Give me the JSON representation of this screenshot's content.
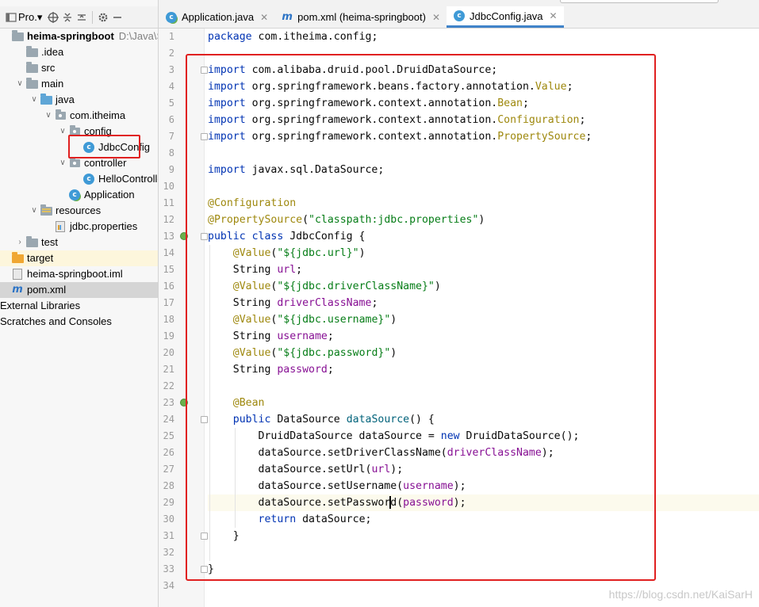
{
  "project_toolbar": {
    "view_label": "Pro.▾",
    "icons": [
      "globe-icon",
      "collapse-icon",
      "expand-icon",
      "gear-icon",
      "minimize-icon"
    ]
  },
  "tree": [
    {
      "label": "heima-springboot",
      "hint": "D:\\Java\\Spring",
      "icon": "module-folder",
      "bold": true,
      "indent": 0,
      "arrow": ""
    },
    {
      "label": ".idea",
      "icon": "folder",
      "indent": 1,
      "arrow": ""
    },
    {
      "label": "src",
      "icon": "folder",
      "indent": 1,
      "arrow": ""
    },
    {
      "label": "main",
      "icon": "folder",
      "indent": 1,
      "arrow": "down"
    },
    {
      "label": "java",
      "icon": "source-folder",
      "indent": 2,
      "arrow": "down"
    },
    {
      "label": "com.itheima",
      "icon": "package",
      "indent": 3,
      "arrow": "down"
    },
    {
      "label": "config",
      "icon": "package",
      "indent": 4,
      "arrow": "down"
    },
    {
      "label": "JdbcConfig",
      "icon": "class",
      "indent": 5,
      "arrow": ""
    },
    {
      "label": "controller",
      "icon": "package",
      "indent": 4,
      "arrow": "down"
    },
    {
      "label": "HelloController",
      "icon": "class",
      "indent": 5,
      "arrow": ""
    },
    {
      "label": "Application",
      "icon": "spring-class",
      "indent": 4,
      "arrow": ""
    },
    {
      "label": "resources",
      "icon": "resources-folder",
      "indent": 2,
      "arrow": "down"
    },
    {
      "label": "jdbc.properties",
      "icon": "properties-file",
      "indent": 3,
      "arrow": ""
    },
    {
      "label": "test",
      "icon": "folder",
      "indent": 1,
      "arrow": "right"
    },
    {
      "label": "target",
      "icon": "excluded-folder",
      "indent": 0,
      "arrow": "",
      "excluded": true
    },
    {
      "label": "heima-springboot.iml",
      "icon": "iml-file",
      "indent": 0,
      "arrow": ""
    },
    {
      "label": "pom.xml",
      "icon": "maven-file",
      "indent": 0,
      "arrow": "",
      "selected": true
    },
    {
      "label": "External Libraries",
      "icon": "none",
      "indent": 0,
      "arrow": ""
    },
    {
      "label": "Scratches and Consoles",
      "icon": "none",
      "indent": 0,
      "arrow": ""
    }
  ],
  "tabs": [
    {
      "label": "Application.java",
      "icon": "spring-class",
      "active": false
    },
    {
      "label": "pom.xml (heima-springboot)",
      "icon": "maven-file",
      "active": false
    },
    {
      "label": "JdbcConfig.java",
      "icon": "class",
      "active": true
    }
  ],
  "editor": {
    "current_line": 29,
    "lines": [
      [
        [
          "kw",
          "package "
        ],
        [
          "p",
          "com.itheima.config;"
        ]
      ],
      [],
      [
        [
          "kw",
          "import "
        ],
        [
          "p",
          "com.alibaba.druid.pool.DruidDataSource;"
        ]
      ],
      [
        [
          "kw",
          "import "
        ],
        [
          "p",
          "org.springframework.beans.factory.annotation."
        ],
        [
          "ann",
          "Value"
        ],
        [
          "p",
          ";"
        ]
      ],
      [
        [
          "kw",
          "import "
        ],
        [
          "p",
          "org.springframework.context.annotation."
        ],
        [
          "ann",
          "Bean"
        ],
        [
          "p",
          ";"
        ]
      ],
      [
        [
          "kw",
          "import "
        ],
        [
          "p",
          "org.springframework.context.annotation."
        ],
        [
          "ann",
          "Configuration"
        ],
        [
          "p",
          ";"
        ]
      ],
      [
        [
          "kw",
          "import "
        ],
        [
          "p",
          "org.springframework.context.annotation."
        ],
        [
          "ann",
          "PropertySource"
        ],
        [
          "p",
          ";"
        ]
      ],
      [],
      [
        [
          "kw",
          "import "
        ],
        [
          "p",
          "javax.sql.DataSource;"
        ]
      ],
      [],
      [
        [
          "ann",
          "@Configuration"
        ]
      ],
      [
        [
          "ann",
          "@PropertySource"
        ],
        [
          "p",
          "("
        ],
        [
          "str",
          "\"classpath:jdbc.properties\""
        ],
        [
          "p",
          ")"
        ]
      ],
      [
        [
          "kw",
          "public class "
        ],
        [
          "p",
          "JdbcConfig {"
        ]
      ],
      [
        [
          "p",
          "    "
        ],
        [
          "ann",
          "@Value"
        ],
        [
          "p",
          "("
        ],
        [
          "str",
          "\"${jdbc.url}\""
        ],
        [
          "p",
          ")"
        ]
      ],
      [
        [
          "p",
          "    String "
        ],
        [
          "fld",
          "url"
        ],
        [
          "p",
          ";"
        ]
      ],
      [
        [
          "p",
          "    "
        ],
        [
          "ann",
          "@Value"
        ],
        [
          "p",
          "("
        ],
        [
          "str",
          "\"${jdbc.driverClassName}\""
        ],
        [
          "p",
          ")"
        ]
      ],
      [
        [
          "p",
          "    String "
        ],
        [
          "fld",
          "driverClassName"
        ],
        [
          "p",
          ";"
        ]
      ],
      [
        [
          "p",
          "    "
        ],
        [
          "ann",
          "@Value"
        ],
        [
          "p",
          "("
        ],
        [
          "str",
          "\"${jdbc.username}\""
        ],
        [
          "p",
          ")"
        ]
      ],
      [
        [
          "p",
          "    String "
        ],
        [
          "fld",
          "username"
        ],
        [
          "p",
          ";"
        ]
      ],
      [
        [
          "p",
          "    "
        ],
        [
          "ann",
          "@Value"
        ],
        [
          "p",
          "("
        ],
        [
          "str",
          "\"${jdbc.password}\""
        ],
        [
          "p",
          ")"
        ]
      ],
      [
        [
          "p",
          "    String "
        ],
        [
          "fld",
          "password"
        ],
        [
          "p",
          ";"
        ]
      ],
      [],
      [
        [
          "p",
          "    "
        ],
        [
          "ann",
          "@Bean"
        ]
      ],
      [
        [
          "p",
          "    "
        ],
        [
          "kw",
          "public "
        ],
        [
          "p",
          "DataSource "
        ],
        [
          "fn",
          "dataSource"
        ],
        [
          "p",
          "() {"
        ]
      ],
      [
        [
          "p",
          "        DruidDataSource dataSource = "
        ],
        [
          "kw",
          "new "
        ],
        [
          "p",
          "DruidDataSource();"
        ]
      ],
      [
        [
          "p",
          "        dataSource.setDriverClassName("
        ],
        [
          "fld",
          "driverClassName"
        ],
        [
          "p",
          ");"
        ]
      ],
      [
        [
          "p",
          "        dataSource.setUrl("
        ],
        [
          "fld",
          "url"
        ],
        [
          "p",
          ");"
        ]
      ],
      [
        [
          "p",
          "        dataSource.setUsername("
        ],
        [
          "fld",
          "username"
        ],
        [
          "p",
          ");"
        ]
      ],
      [
        [
          "p",
          "        dataSource.setPassword("
        ],
        [
          "fld",
          "password"
        ],
        [
          "p",
          ");"
        ]
      ],
      [
        [
          "p",
          "        "
        ],
        [
          "kw",
          "return "
        ],
        [
          "p",
          "dataSource;"
        ]
      ],
      [
        [
          "p",
          "    }"
        ]
      ],
      [],
      [
        [
          "p",
          "}"
        ]
      ],
      []
    ]
  },
  "watermark": "https://blog.csdn.net/KaiSarH",
  "colors": {
    "keyword": "#0033b3",
    "annotation": "#9e880d",
    "string": "#067d17",
    "field": "#871094",
    "method": "#00627a",
    "highlight_box": "#e02020",
    "active_tab_underline": "#4083c9"
  }
}
